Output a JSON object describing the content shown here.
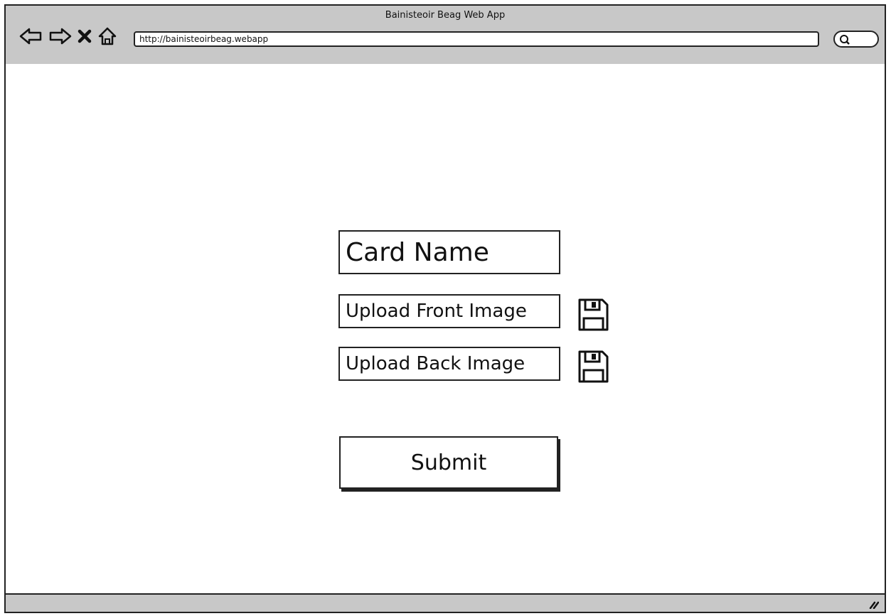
{
  "window": {
    "title": "Bainisteoir Beag Web App"
  },
  "toolbar": {
    "back_icon": "back-arrow-icon",
    "forward_icon": "forward-arrow-icon",
    "stop_icon": "stop-x-icon",
    "home_icon": "home-icon",
    "url": "http://bainisteoirbeag.webapp",
    "search_icon": "search-icon"
  },
  "form": {
    "card_name_placeholder": "Card Name",
    "upload_front_label": "Upload Front Image",
    "upload_back_label": "Upload Back Image",
    "save_icon": "floppy-disk-icon",
    "submit_label": "Submit"
  }
}
